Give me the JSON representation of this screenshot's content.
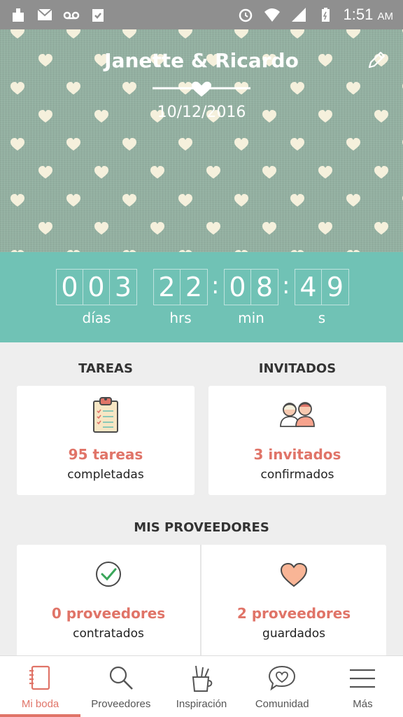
{
  "status_bar": {
    "time": "1:51",
    "ampm": "AM"
  },
  "header": {
    "couple_name": "Janette & Ricardo",
    "date": "10/12/2016"
  },
  "countdown": {
    "days": [
      "0",
      "0",
      "3"
    ],
    "hours": [
      "2",
      "2"
    ],
    "minutes": [
      "0",
      "8"
    ],
    "seconds": [
      "4",
      "9"
    ],
    "labels": {
      "days": "días",
      "hours": "hrs",
      "minutes": "min",
      "seconds": "s"
    }
  },
  "tasks": {
    "title": "TAREAS",
    "value": "95 tareas",
    "sub": "completadas"
  },
  "guests": {
    "title": "INVITADOS",
    "value": "3 invitados",
    "sub": "confirmados"
  },
  "vendors": {
    "title": "MIS PROVEEDORES",
    "hired": {
      "value": "0 proveedores",
      "sub": "contratados"
    },
    "saved": {
      "value": "2 proveedores",
      "sub": "guardados"
    }
  },
  "nav": [
    {
      "label": "Mi boda",
      "icon": "notebook-icon",
      "active": true
    },
    {
      "label": "Proveedores",
      "icon": "search-icon"
    },
    {
      "label": "Inspiración",
      "icon": "pencil-cup-icon"
    },
    {
      "label": "Comunidad",
      "icon": "chat-heart-icon"
    },
    {
      "label": "Más",
      "icon": "menu-icon"
    }
  ],
  "colors": {
    "accent": "#e07468",
    "teal": "#70c2b5",
    "hero_bg": "#93b0a1",
    "heart": "#f5f0dc"
  }
}
